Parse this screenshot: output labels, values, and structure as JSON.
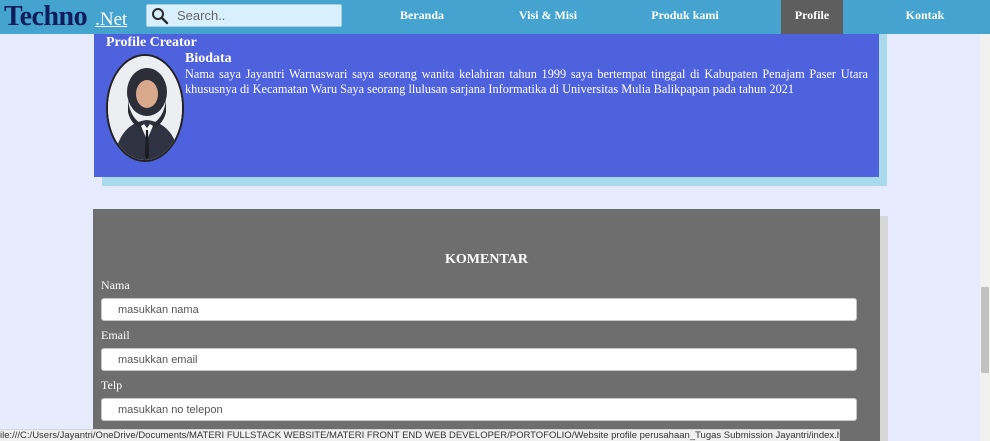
{
  "header": {
    "logo_main": "Techno",
    "logo_sub": ".Net",
    "search_placeholder": "Search..",
    "nav": [
      {
        "label": "Beranda"
      },
      {
        "label": "Visi & Misi"
      },
      {
        "label": "Produk kami"
      },
      {
        "label": "Profile"
      },
      {
        "label": "Kontak"
      }
    ],
    "active_nav": "Profile"
  },
  "profile": {
    "title": "Profile Creator",
    "bio_title": "Biodata",
    "bio_text": "Nama saya Jayantri Warnaswari saya seorang wanita kelahiran tahun 1999 saya bertempat tinggal di Kabupaten Penajam Paser Utara khususnya di Kecamatan Waru Saya seorang llulusan sarjana Informatika di Universitas Mulia Balikpapan pada tahun 2021"
  },
  "comment": {
    "title": "KOMENTAR",
    "fields": [
      {
        "label": "Nama",
        "placeholder": "masukkan nama"
      },
      {
        "label": "Email",
        "placeholder": "masukkan email"
      },
      {
        "label": "Telp",
        "placeholder": "masukkan no telepon"
      }
    ]
  },
  "status_url": "ile:///C:/Users/Jayantri/OneDrive/Documents/MATERI FULLSTACK WEBSITE/MATERI FRONT END WEB DEVELOPER/PORTOFOLIO/Website profile perusahaan_Tugas Submission Jayantri/index.html#profile",
  "colors": {
    "header": "#45a3cf",
    "logo": "#0f1d5c",
    "profile_card": "#4f62de",
    "comment_box": "#6e6e6e",
    "active_nav": "#5e5e5e"
  }
}
